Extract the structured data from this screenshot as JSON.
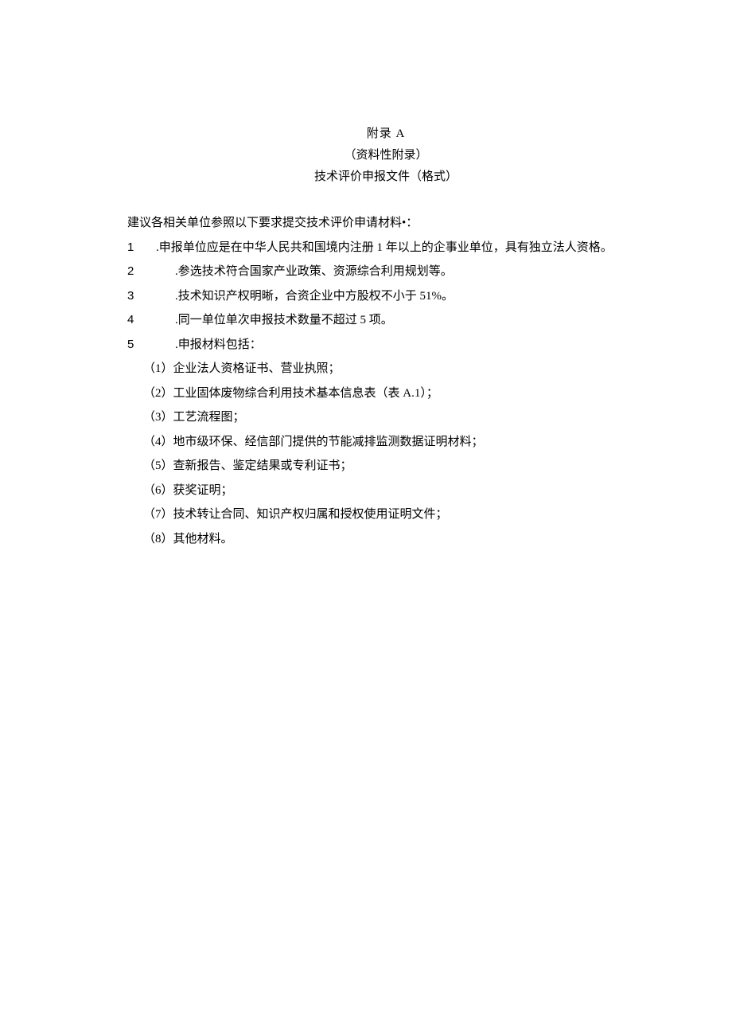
{
  "header": {
    "appendix": "附录 A",
    "subtitle1": "（资料性附录）",
    "subtitle2": "技术评价申报文件（格式）"
  },
  "intro": "建议各相关单位参照以下要求提交技术评价申请材料•：",
  "items": [
    {
      "num": "1",
      "gap": "small",
      "text": ".申报单位应是在中华人民共和国境内注册 1 年以上的企事业单位，具有独立法人资格。"
    },
    {
      "num": "2",
      "gap": "large",
      "text": ".参选技术符合国家产业政策、资源综合利用规划等。"
    },
    {
      "num": "3",
      "gap": "large",
      "text": ".技术知识产权明晰，合资企业中方股权不小于 51%。"
    },
    {
      "num": "4",
      "gap": "large",
      "text": ".同一单位单次申报技术数量不超过 5 项。"
    },
    {
      "num": "5",
      "gap": "large",
      "text": ".申报材料包括："
    }
  ],
  "subitems": [
    "（1）企业法人资格证书、营业执照；",
    "（2）工业固体废物综合利用技术基本信息表（表 A.1）；",
    "（3）工艺流程图；",
    "（4）地市级环保、经信部门提供的节能减排监测数据证明材料；",
    "（5）查新报告、鉴定结果或专利证书；",
    "（6）获奖证明；",
    "（7）技术转让合同、知识产权归属和授权使用证明文件；",
    "（8）其他材料。"
  ]
}
